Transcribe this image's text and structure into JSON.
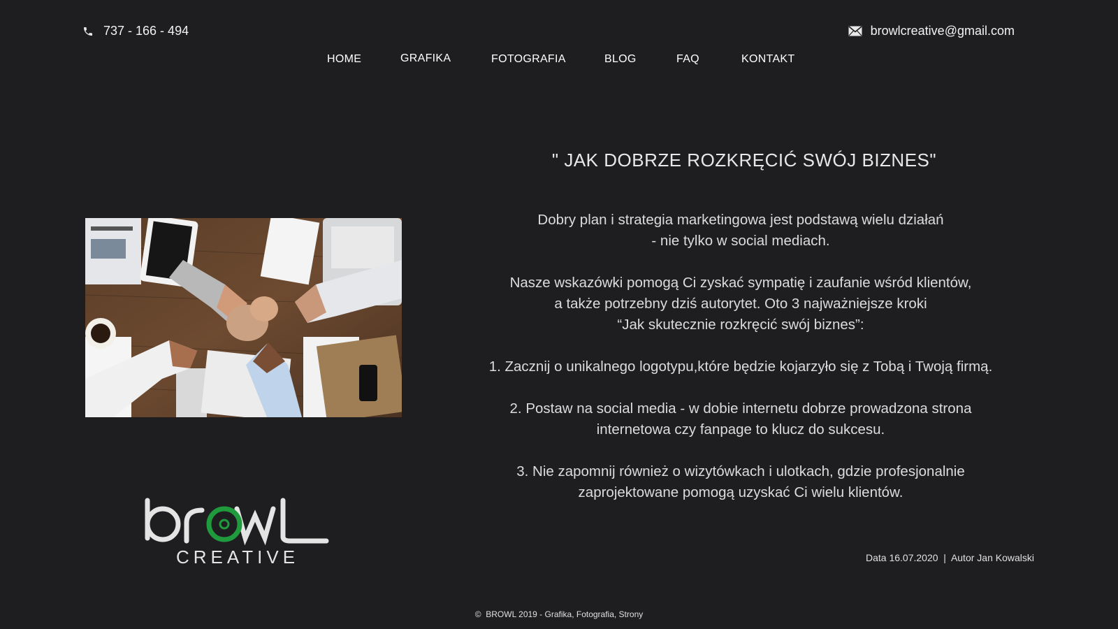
{
  "header": {
    "phone": "737 - 166 - 494",
    "email": "browlcreative@gmail.com",
    "phone_icon": "phone-icon",
    "mail_icon": "envelope-icon"
  },
  "nav": {
    "items": [
      "HOME",
      "GRAFIKA",
      "FOTOGRAFIA",
      "BLOG",
      "FAQ",
      "KONTAKT"
    ]
  },
  "article": {
    "title": "\" JAK DOBRZE ROZKRĘCIĆ SWÓJ BIZNES\"",
    "p1_line1": "Dobry plan i strategia marketingowa jest podstawą wielu działań",
    "p1_line2": "- nie tylko w social mediach.",
    "p2_line1": "Nasze wskazówki pomogą Ci zyskać sympatię i zaufanie wśród klientów,",
    "p2_line2": "a także potrzebny dziś autorytet. Oto 3 najważniejsze kroki",
    "p2_line3": "“Jak skutecznie rozkręcić swój biznes”:",
    "step1": "1. Zacznij o unikalnego logotypu,które będzie kojarzyło się z Tobą i Twoją firmą.",
    "step2_line1": "2. Postaw na social media - w dobie internetu dobrze prowadzona strona",
    "step2_line2": "internetowa czy fanpage to klucz do sukcesu.",
    "step3_line1": "3. Nie zapomnij również o wizytówkach i ulotkach, gdzie profesjonalnie",
    "step3_line2": "zaprojektowane pomogą uzyskać Ci wielu klientów.",
    "meta": "Data 16.07.2020  |  Autor Jan Kowalski"
  },
  "logo": {
    "word": "browl",
    "sub": "CREATIVE",
    "accent": "#1f9a3c"
  },
  "footer": {
    "copyright": "©  BROWL 2019 - Grafika, Fotografia, Strony"
  },
  "colors": {
    "background": "#1e1e21",
    "text": "#e6e6e6",
    "accent": "#1f9a3c"
  }
}
